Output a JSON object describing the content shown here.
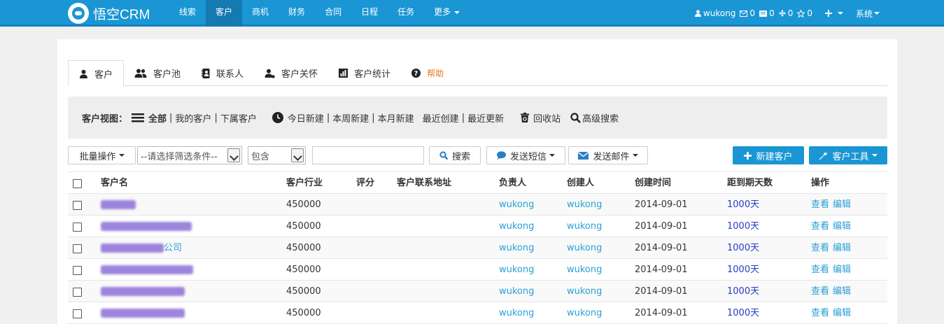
{
  "navbar": {
    "brand": "悟空CRM",
    "items": [
      {
        "label": "线索",
        "active": false
      },
      {
        "label": "客户",
        "active": true
      },
      {
        "label": "商机",
        "active": false
      },
      {
        "label": "财务",
        "active": false
      },
      {
        "label": "合同",
        "active": false
      },
      {
        "label": "日程",
        "active": false
      },
      {
        "label": "任务",
        "active": false
      },
      {
        "label": "更多",
        "active": false
      }
    ],
    "user": "wukong",
    "mail_count": "0",
    "message_count": "0",
    "task_count": "0",
    "star_count": "0",
    "system_label": "系统"
  },
  "tabs": [
    {
      "label": "客户",
      "icon": "user-icon"
    },
    {
      "label": "客户池",
      "icon": "users-icon"
    },
    {
      "label": "联系人",
      "icon": "contacts-icon"
    },
    {
      "label": "客户关怀",
      "icon": "user-care-icon"
    },
    {
      "label": "客户统计",
      "icon": "stats-icon"
    },
    {
      "label": "帮助",
      "icon": "help-icon"
    }
  ],
  "view": {
    "label": "客户视图：",
    "all": "全部",
    "mine": "我的客户",
    "sub": "下属客户",
    "today": "今日新建",
    "week": "本周新建",
    "month": "本月新建",
    "recent_created": "最近创建",
    "recent_updated": "最近更新",
    "recycle": "回收站",
    "advanced_search": "高级搜索"
  },
  "toolbar": {
    "batch": "批量操作",
    "filter_placeholder": "--请选择筛选条件--",
    "condition": "包含",
    "search_value": "",
    "search": "搜索",
    "sms": "发送短信",
    "email": "发送邮件",
    "new_customer": "新建客户",
    "tools": "客户工具"
  },
  "table": {
    "headers": {
      "name": "客户名",
      "industry": "客户行业",
      "rating": "评分",
      "address": "客户联系地址",
      "owner": "负责人",
      "creator": "创建人",
      "created": "创建时间",
      "days": "距到期天数",
      "actions": "操作"
    },
    "rows": [
      {
        "name": "",
        "industry": "450000",
        "rating": "",
        "address": "",
        "owner": "wukong",
        "creator": "wukong",
        "created": "2014-09-01",
        "days": "1000天",
        "view": "查看",
        "edit": "编辑"
      },
      {
        "name": "",
        "industry": "450000",
        "rating": "",
        "address": "",
        "owner": "wukong",
        "creator": "wukong",
        "created": "2014-09-01",
        "days": "1000天",
        "view": "查看",
        "edit": "编辑"
      },
      {
        "name": "公司",
        "industry": "450000",
        "rating": "",
        "address": "",
        "owner": "wukong",
        "creator": "wukong",
        "created": "2014-09-01",
        "days": "1000天",
        "view": "查看",
        "edit": "编辑"
      },
      {
        "name": "",
        "industry": "450000",
        "rating": "",
        "address": "",
        "owner": "wukong",
        "creator": "wukong",
        "created": "2014-09-01",
        "days": "1000天",
        "view": "查看",
        "edit": "编辑"
      },
      {
        "name": "",
        "industry": "450000",
        "rating": "",
        "address": "",
        "owner": "wukong",
        "creator": "wukong",
        "created": "2014-09-01",
        "days": "1000天",
        "view": "查看",
        "edit": "编辑"
      },
      {
        "name": "",
        "industry": "450000",
        "rating": "",
        "address": "",
        "owner": "wukong",
        "creator": "wukong",
        "created": "2014-09-01",
        "days": "1000天",
        "view": "查看",
        "edit": "编辑"
      }
    ]
  },
  "colors": {
    "navbar": "#1a96d4",
    "link": "#2a9fd6",
    "days": "#2a3bbf",
    "help": "#e8791d"
  }
}
